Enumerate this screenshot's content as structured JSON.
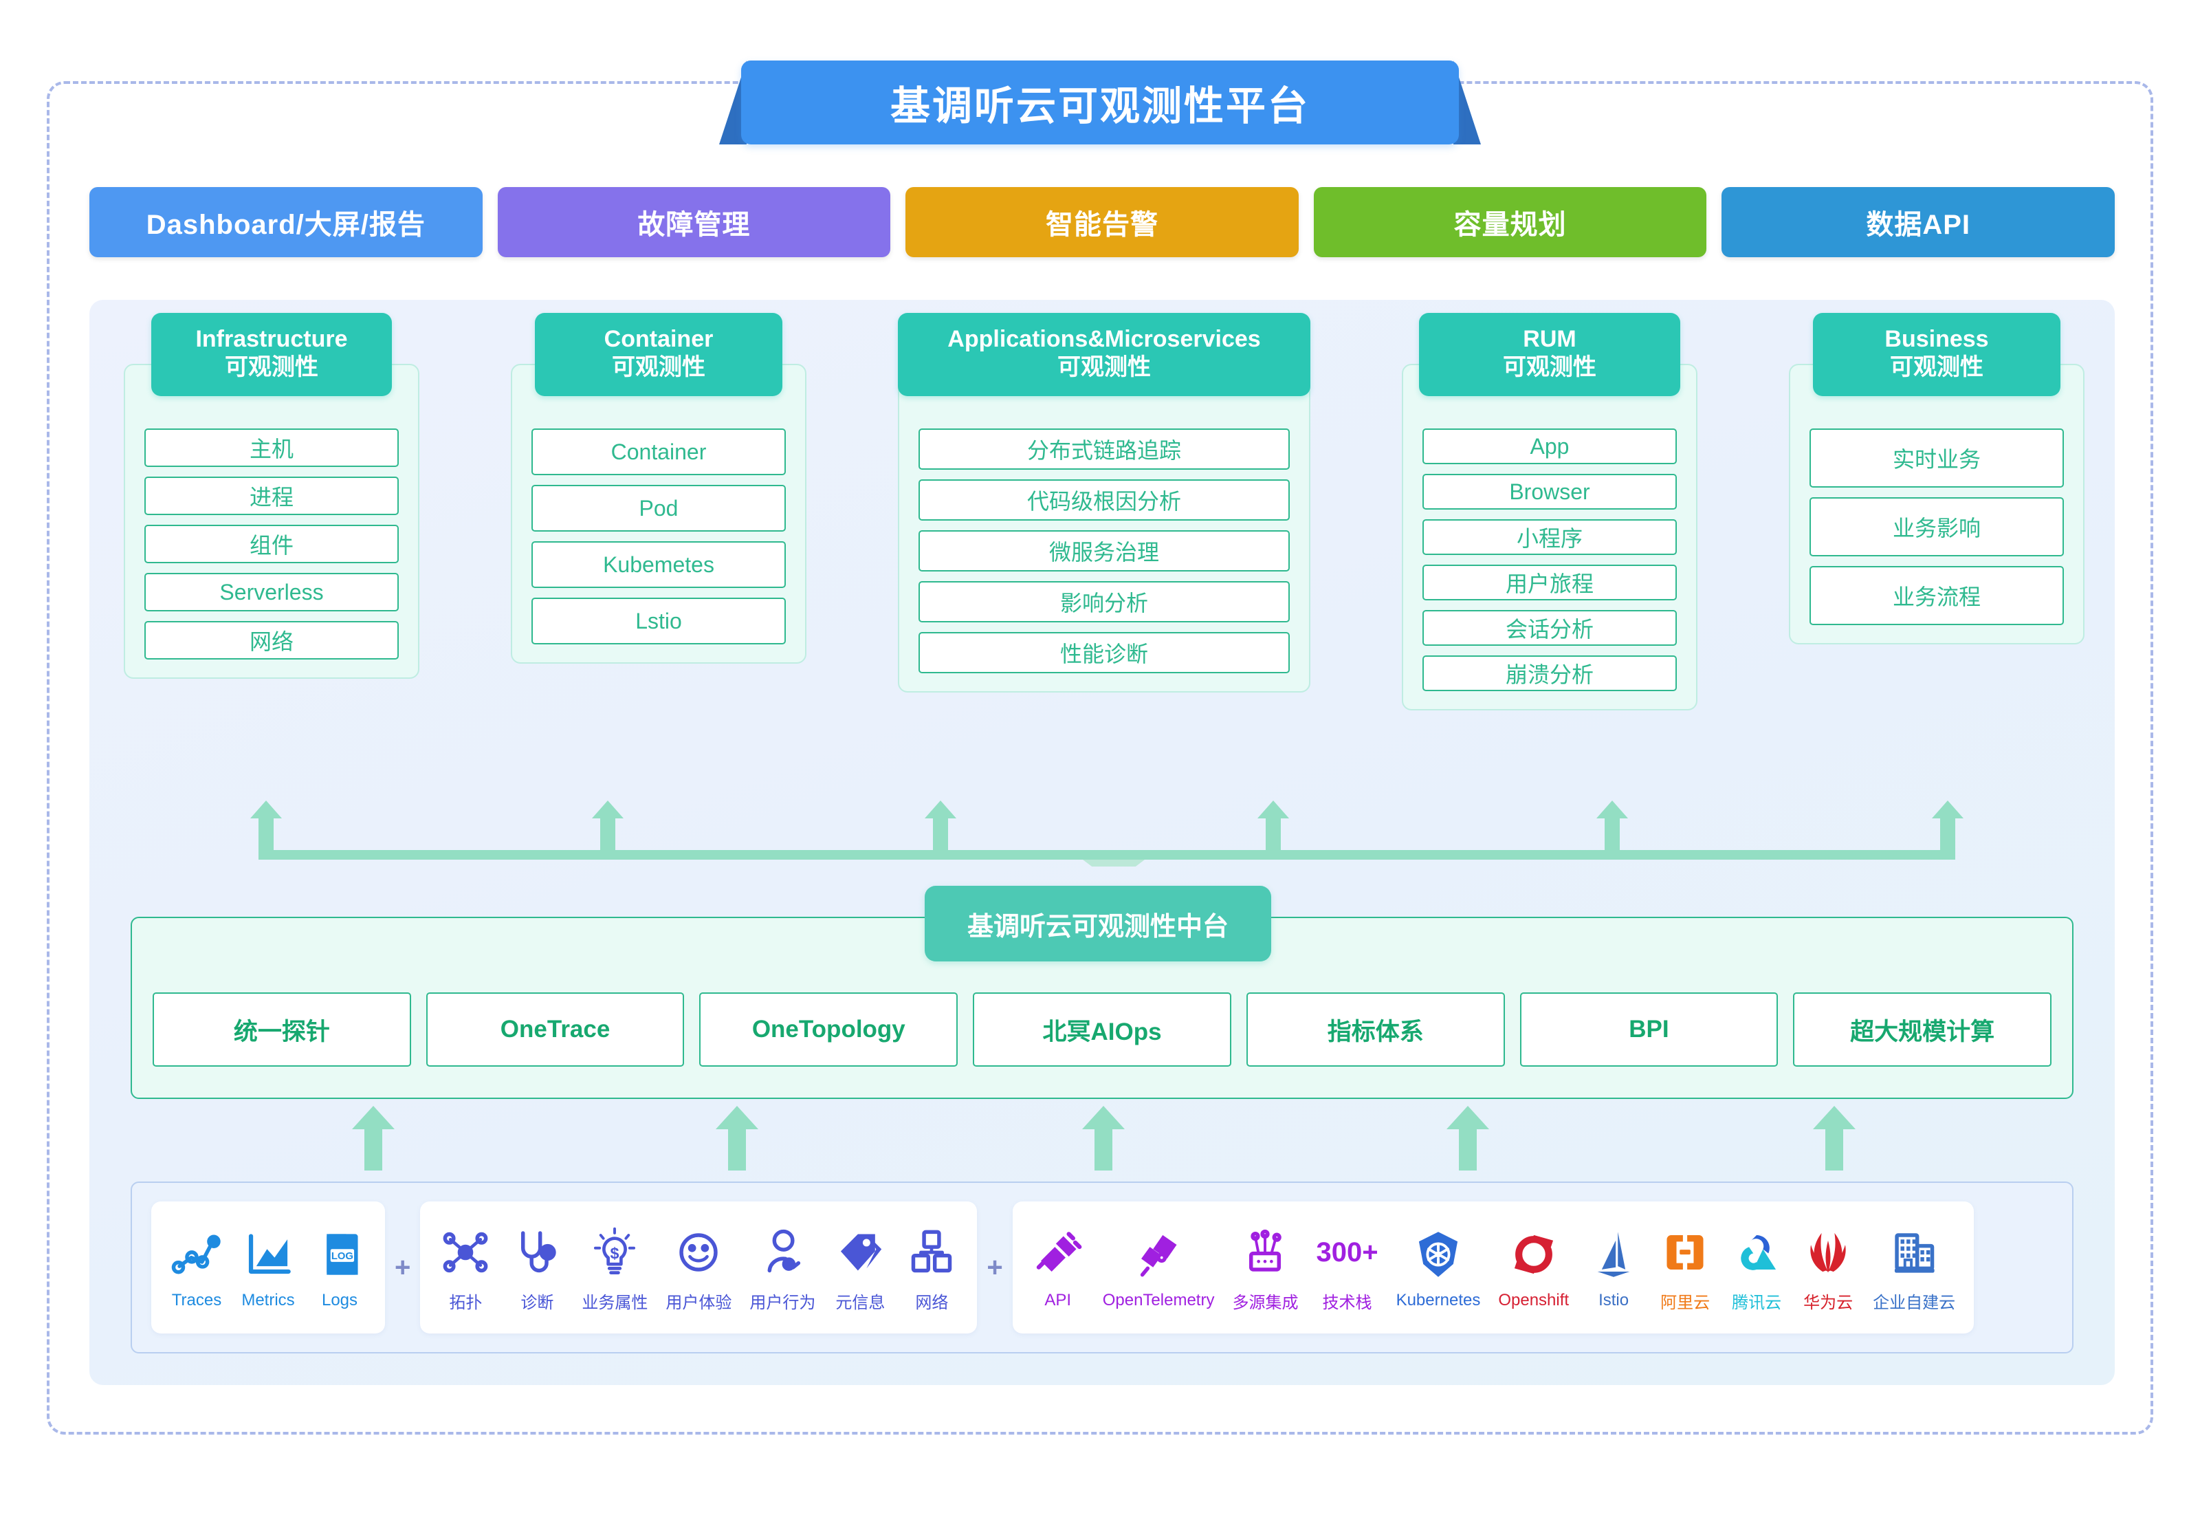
{
  "title": "基调听云可观测性平台",
  "nav": [
    {
      "label": "Dashboard/大屏/报告",
      "color": "#4E98F2"
    },
    {
      "label": "故障管理",
      "color": "#8572EB"
    },
    {
      "label": "智能告警",
      "color": "#E5A412"
    },
    {
      "label": "容量规划",
      "color": "#6FBE2B"
    },
    {
      "label": "数据API",
      "color": "#2E96D6"
    }
  ],
  "pillars": [
    {
      "en": "Infrastructure",
      "cn": "可观测性",
      "items": [
        "主机",
        "进程",
        "组件",
        "Serverless",
        "网络"
      ]
    },
    {
      "en": "Container",
      "cn": "可观测性",
      "items": [
        "Container",
        "Pod",
        "Kubemetes",
        "Lstio"
      ]
    },
    {
      "en": "Applications&Microservices",
      "cn": "可观测性",
      "items": [
        "分布式链路追踪",
        "代码级根因分析",
        "微服务治理",
        "影响分析",
        "性能诊断"
      ]
    },
    {
      "en": "RUM",
      "cn": "可观测性",
      "items": [
        "App",
        "Browser",
        "小程序",
        "用户旅程",
        "会话分析",
        "崩溃分析"
      ]
    },
    {
      "en": "Business",
      "cn": "可观测性",
      "items": [
        "实时业务",
        "业务影响",
        "业务流程"
      ]
    }
  ],
  "platform": {
    "label": "基调听云可观测性中台",
    "capabilities": [
      "统一探针",
      "OneTrace",
      "OneTopology",
      "北冥AIOps",
      "指标体系",
      "BPI",
      "超大规模计算"
    ]
  },
  "sources": {
    "separator": "+",
    "groups": [
      {
        "color": "#1E8BE0",
        "items": [
          {
            "label": "Traces",
            "icon": "traces-icon"
          },
          {
            "label": "Metrics",
            "icon": "metrics-icon"
          },
          {
            "label": "Logs",
            "icon": "logs-icon"
          }
        ]
      },
      {
        "color": "#4A56D6",
        "items": [
          {
            "label": "拓扑",
            "icon": "topology-icon"
          },
          {
            "label": "诊断",
            "icon": "stethoscope-icon"
          },
          {
            "label": "业务属性",
            "icon": "lightbulb-dollar-icon"
          },
          {
            "label": "用户体验",
            "icon": "smiley-face-icon"
          },
          {
            "label": "用户行为",
            "icon": "user-behavior-icon"
          },
          {
            "label": "元信息",
            "icon": "tag-icon"
          },
          {
            "label": "网络",
            "icon": "network-tree-icon"
          }
        ]
      },
      {
        "color": "#A020E0",
        "items": [
          {
            "label": "API",
            "icon": "plug-icon",
            "color": "#A020E0"
          },
          {
            "label": "OpenTelemetry",
            "icon": "telescope-icon",
            "color": "#A020E0"
          },
          {
            "label": "多源集成",
            "icon": "router-icon",
            "color": "#A020E0"
          },
          {
            "label": "技术栈",
            "icon": "count-300-plus",
            "color": "#A020E0",
            "badge": "300+"
          },
          {
            "label": "Kubernetes",
            "icon": "kubernetes-logo",
            "color": "#2E6CD6"
          },
          {
            "label": "Openshift",
            "icon": "openshift-logo",
            "color": "#D62033"
          },
          {
            "label": "Istio",
            "icon": "istio-logo",
            "color": "#3A6FC4"
          },
          {
            "label": "阿里云",
            "icon": "aliyun-logo",
            "color": "#F07A18"
          },
          {
            "label": "腾讯云",
            "icon": "tencent-cloud-logo",
            "color": "#1FBFD8"
          },
          {
            "label": "华为云",
            "icon": "huawei-cloud-logo",
            "color": "#D7222C"
          },
          {
            "label": "企业自建云",
            "icon": "enterprise-cloud-icon",
            "color": "#3A72C8"
          }
        ]
      }
    ]
  }
}
